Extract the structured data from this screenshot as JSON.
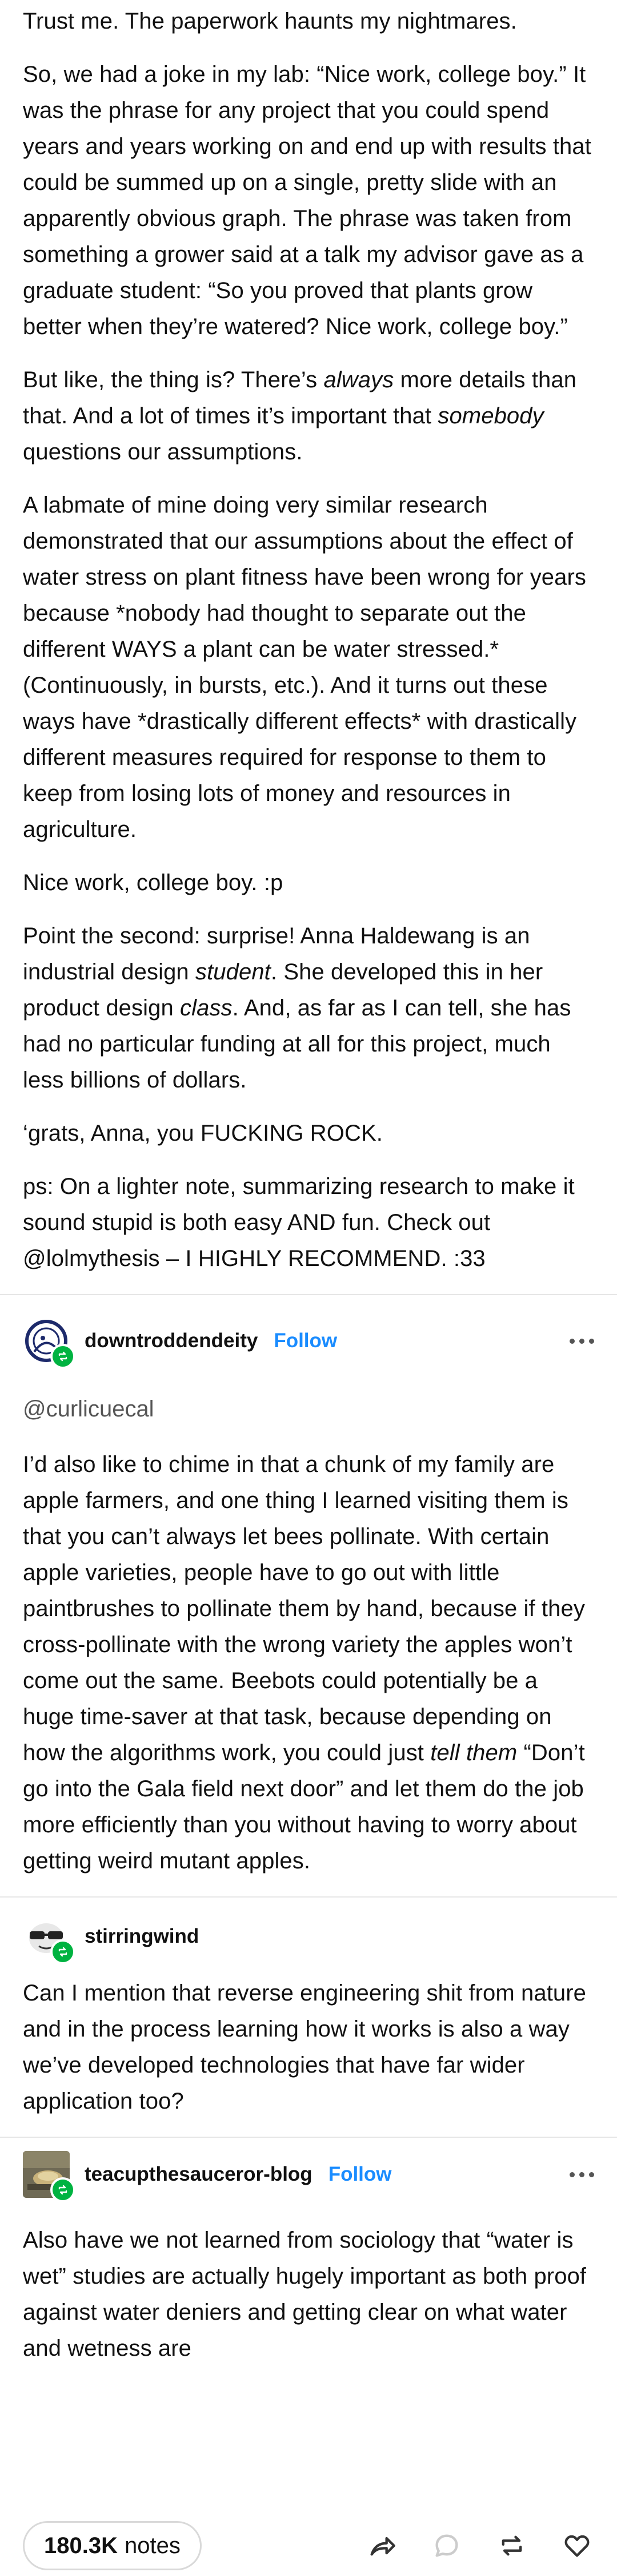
{
  "post_body": {
    "p1": "Trust me.  The paperwork haunts my nightmares.",
    "p2": "So, we had a joke in my lab: “Nice work, college boy.” It was the phrase for any project that you could spend years and years working on and end up with results that could be summed up on a single, pretty slide with an apparently obvious graph.  The phrase was taken from something a grower said at a talk my advisor gave as a graduate student: “So you proved that plants grow better when they’re watered? Nice work, college boy.”",
    "p3_a": "But like, the thing is?  There’s ",
    "p3_em1": "always",
    "p3_b": " more details than that.  And a lot of times it’s important that ",
    "p3_em2": "somebody",
    "p3_c": " questions our assumptions.",
    "p4": "A labmate of mine doing very similar research demonstrated that our assumptions about the effect of water stress on plant fitness have been wrong for years because *nobody had thought to separate out the different WAYS a plant can be water stressed.* (Continuously, in bursts, etc.). And it turns out these ways have *drastically different effects* with drastically different measures required for response to them to keep from losing lots of money and resources in agriculture.",
    "p5": "Nice work, college boy. :p",
    "p6_a": "Point the second: surprise! Anna Haldewang is an industrial design ",
    "p6_em1": "student",
    "p6_b": ".  She developed this in her product design ",
    "p6_em2": "class",
    "p6_c": ".  And, as far as I can tell, she has had no particular funding at all for this project, much less billions of dollars.",
    "p7": "‘grats, Anna, you FUCKING ROCK.",
    "p8": "ps: On a lighter note, summarizing research to make it sound stupid is both easy AND fun. Check out @lolmythesis – I HIGHLY RECOMMEND. :33"
  },
  "reblog1": {
    "username": "downtroddendeity",
    "follow_label": "Follow",
    "mention": "@curlicuecal",
    "text_a": "I’d also like to chime in that a chunk of my family are apple farmers, and one thing I learned visiting them is that you can’t always let bees pollinate. With certain apple varieties, people have to go out with little paintbrushes to pollinate them by hand, because if they cross-pollinate with the wrong variety the apples won’t come out the same. Beebots could potentially be a huge time-saver at that task, because depending on how the algorithms work, you could just ",
    "text_em": "tell them",
    "text_b": " “Don’t go into the Gala field next door” and let them do the job more efficiently than you without having to worry about getting weird mutant apples."
  },
  "reblog2": {
    "username": "stirringwind",
    "text": "Can I mention that reverse engineering shit from nature and in the process learning how it works is also a way we’ve developed technologies that have far wider application too?"
  },
  "reblog3": {
    "username": "teacupthesauceror-blog",
    "follow_label": "Follow",
    "text": "Also have we not learned from sociology that “water is wet” studies are actually hugely important as both proof against water deniers and getting clear on what water and wetness are"
  },
  "footer": {
    "notes_count": "180.3K",
    "notes_label": "notes"
  },
  "icons": {
    "share": "share-icon",
    "reply": "reply-icon",
    "reblog": "reblog-icon",
    "like": "heart-icon",
    "more": "more-icon"
  },
  "colors": {
    "follow": "#1a8cff",
    "reblog_badge": "#00b341",
    "divider": "#e6e6e6",
    "mention": "#555555"
  }
}
